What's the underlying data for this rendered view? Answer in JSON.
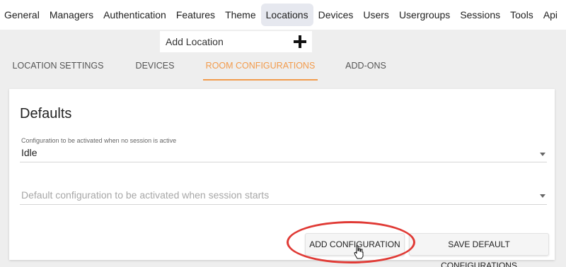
{
  "topnav": {
    "items": [
      {
        "label": "General"
      },
      {
        "label": "Managers"
      },
      {
        "label": "Authentication"
      },
      {
        "label": "Features"
      },
      {
        "label": "Theme"
      },
      {
        "label": "Locations"
      },
      {
        "label": "Devices"
      },
      {
        "label": "Users"
      },
      {
        "label": "Usergroups"
      },
      {
        "label": "Sessions"
      },
      {
        "label": "Tools"
      },
      {
        "label": "Api"
      }
    ],
    "active": "Locations"
  },
  "add_location": {
    "label": "Add Location",
    "icon": "plus-icon"
  },
  "tabs": {
    "items": [
      {
        "label": "LOCATION SETTINGS"
      },
      {
        "label": "DEVICES"
      },
      {
        "label": "ROOM CONFIGURATIONS"
      },
      {
        "label": "ADD-ONS"
      }
    ],
    "active": "ROOM CONFIGURATIONS"
  },
  "defaults": {
    "title": "Defaults",
    "inactive_field": {
      "label": "Configuration to be activated when no session is active",
      "value": "Idle"
    },
    "session_field": {
      "placeholder": "Default configuration to be activated when session starts"
    }
  },
  "buttons": {
    "add_configuration": "ADD CONFIGURATION",
    "save_default_configurations": "SAVE DEFAULT CONFIGURATIONS"
  },
  "colors": {
    "accent": "#f29b4c",
    "highlight": "#e03a35",
    "background": "#eeeeee"
  }
}
